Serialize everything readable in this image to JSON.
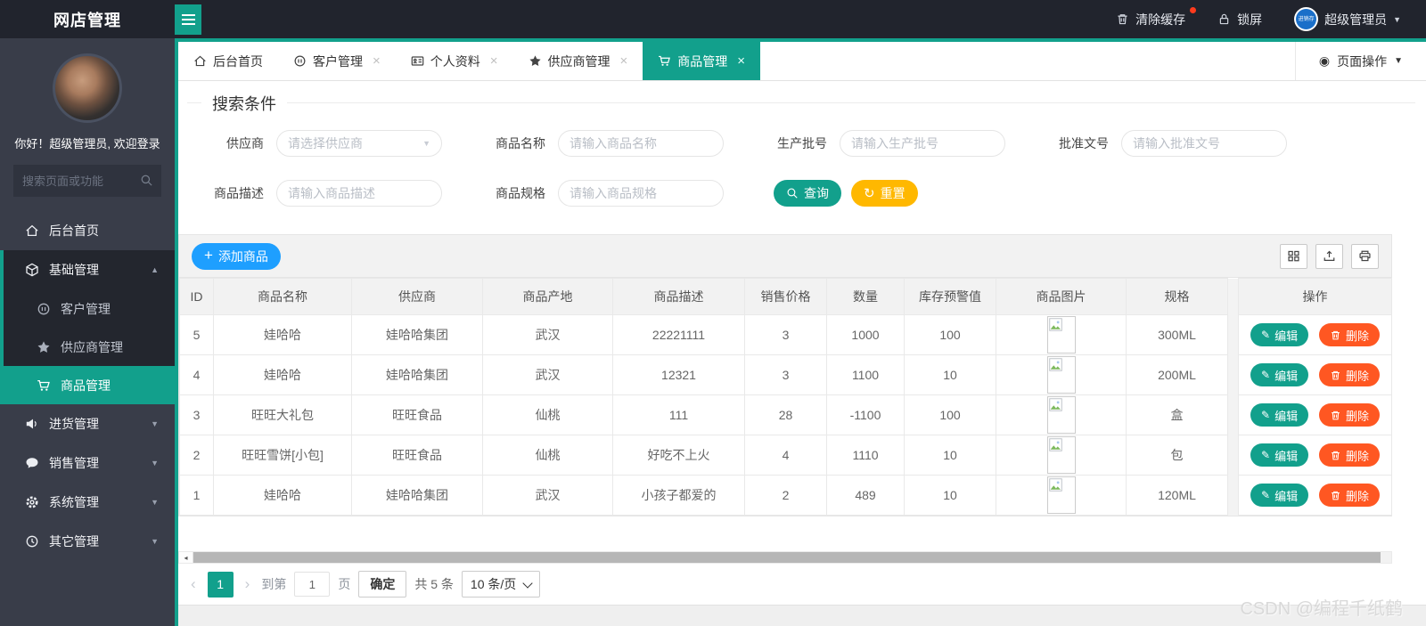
{
  "header": {
    "app_title": "网店管理",
    "clear_cache_label": "清除缓存",
    "lock_screen_label": "锁屏",
    "username": "超级管理员",
    "avatar_logo_text": "进销存"
  },
  "sidebar": {
    "greeting": "你好！超级管理员, 欢迎登录",
    "search_placeholder": "搜索页面或功能",
    "menu": [
      {
        "label": "后台首页",
        "icon": "home-icon"
      },
      {
        "label": "基础管理",
        "icon": "cube-icon",
        "expanded": true,
        "children": [
          {
            "label": "客户管理",
            "icon": "pause-circle-icon"
          },
          {
            "label": "供应商管理",
            "icon": "star-icon"
          },
          {
            "label": "商品管理",
            "icon": "cart-icon",
            "active": true
          }
        ]
      },
      {
        "label": "进货管理",
        "icon": "speaker-icon"
      },
      {
        "label": "销售管理",
        "icon": "chat-icon"
      },
      {
        "label": "系统管理",
        "icon": "gear-icon"
      },
      {
        "label": "其它管理",
        "icon": "clock-icon"
      }
    ]
  },
  "tabs": [
    {
      "label": "后台首页",
      "icon": "home-icon",
      "closable": false
    },
    {
      "label": "客户管理",
      "icon": "pause-circle-icon",
      "closable": true
    },
    {
      "label": "个人资料",
      "icon": "id-card-icon",
      "closable": true
    },
    {
      "label": "供应商管理",
      "icon": "star-icon",
      "closable": true
    },
    {
      "label": "商品管理",
      "icon": "cart-icon",
      "closable": true,
      "active": true
    }
  ],
  "page_actions_label": "页面操作",
  "search_panel": {
    "legend": "搜索条件",
    "supplier_label": "供应商",
    "supplier_placeholder": "请选择供应商",
    "name_label": "商品名称",
    "name_placeholder": "请输入商品名称",
    "batch_label": "生产批号",
    "batch_placeholder": "请输入生产批号",
    "approval_label": "批准文号",
    "approval_placeholder": "请输入批准文号",
    "desc_label": "商品描述",
    "desc_placeholder": "请输入商品描述",
    "spec_label": "商品规格",
    "spec_placeholder": "请输入商品规格",
    "query_label": "查询",
    "reset_label": "重置"
  },
  "toolbar": {
    "add_product_label": "添加商品"
  },
  "table": {
    "columns": [
      "ID",
      "商品名称",
      "供应商",
      "商品产地",
      "商品描述",
      "销售价格",
      "数量",
      "库存预警值",
      "商品图片",
      "规格",
      "操作"
    ],
    "rows": [
      {
        "id": "5",
        "name": "娃哈哈",
        "supplier": "娃哈哈集团",
        "origin": "武汉",
        "desc": "22221111",
        "price": "3",
        "qty": "1000",
        "warn": "100",
        "spec": "300ML"
      },
      {
        "id": "4",
        "name": "娃哈哈",
        "supplier": "娃哈哈集团",
        "origin": "武汉",
        "desc": "12321",
        "price": "3",
        "qty": "1100",
        "warn": "10",
        "spec": "200ML"
      },
      {
        "id": "3",
        "name": "旺旺大礼包",
        "supplier": "旺旺食品",
        "origin": "仙桃",
        "desc": "111",
        "price": "28",
        "qty": "-1100",
        "warn": "100",
        "spec": "盒"
      },
      {
        "id": "2",
        "name": "旺旺雪饼[小包]",
        "supplier": "旺旺食品",
        "origin": "仙桃",
        "desc": "好吃不上火",
        "price": "4",
        "qty": "1110",
        "warn": "10",
        "spec": "包"
      },
      {
        "id": "1",
        "name": "娃哈哈",
        "supplier": "娃哈哈集团",
        "origin": "武汉",
        "desc": "小孩子都爱的",
        "price": "2",
        "qty": "489",
        "warn": "10",
        "spec": "120ML"
      }
    ],
    "actions": {
      "edit": "编辑",
      "delete": "删除"
    }
  },
  "pagination": {
    "current_page": "1",
    "goto_label": "到第",
    "goto_value": "1",
    "page_unit": "页",
    "confirm_label": "确定",
    "total_label": "共 5 条",
    "page_size_label": "10 条/页"
  },
  "watermark": "CSDN @编程千纸鹤",
  "glyphs": {
    "caret_down": "▼",
    "caret_up": "▲",
    "close": "×",
    "prev": "‹",
    "next": "›",
    "plus": "+",
    "pencil": "✎",
    "refresh": "↻",
    "radio": "◉",
    "scroll_left": "◂"
  },
  "colors": {
    "primary_teal": "#12a08c",
    "header_bg": "#21242d",
    "sidebar_bg": "#393d49",
    "add_button_blue": "#1e9fff",
    "reset_yellow": "#ffb800",
    "delete_orange": "#ff5722"
  }
}
